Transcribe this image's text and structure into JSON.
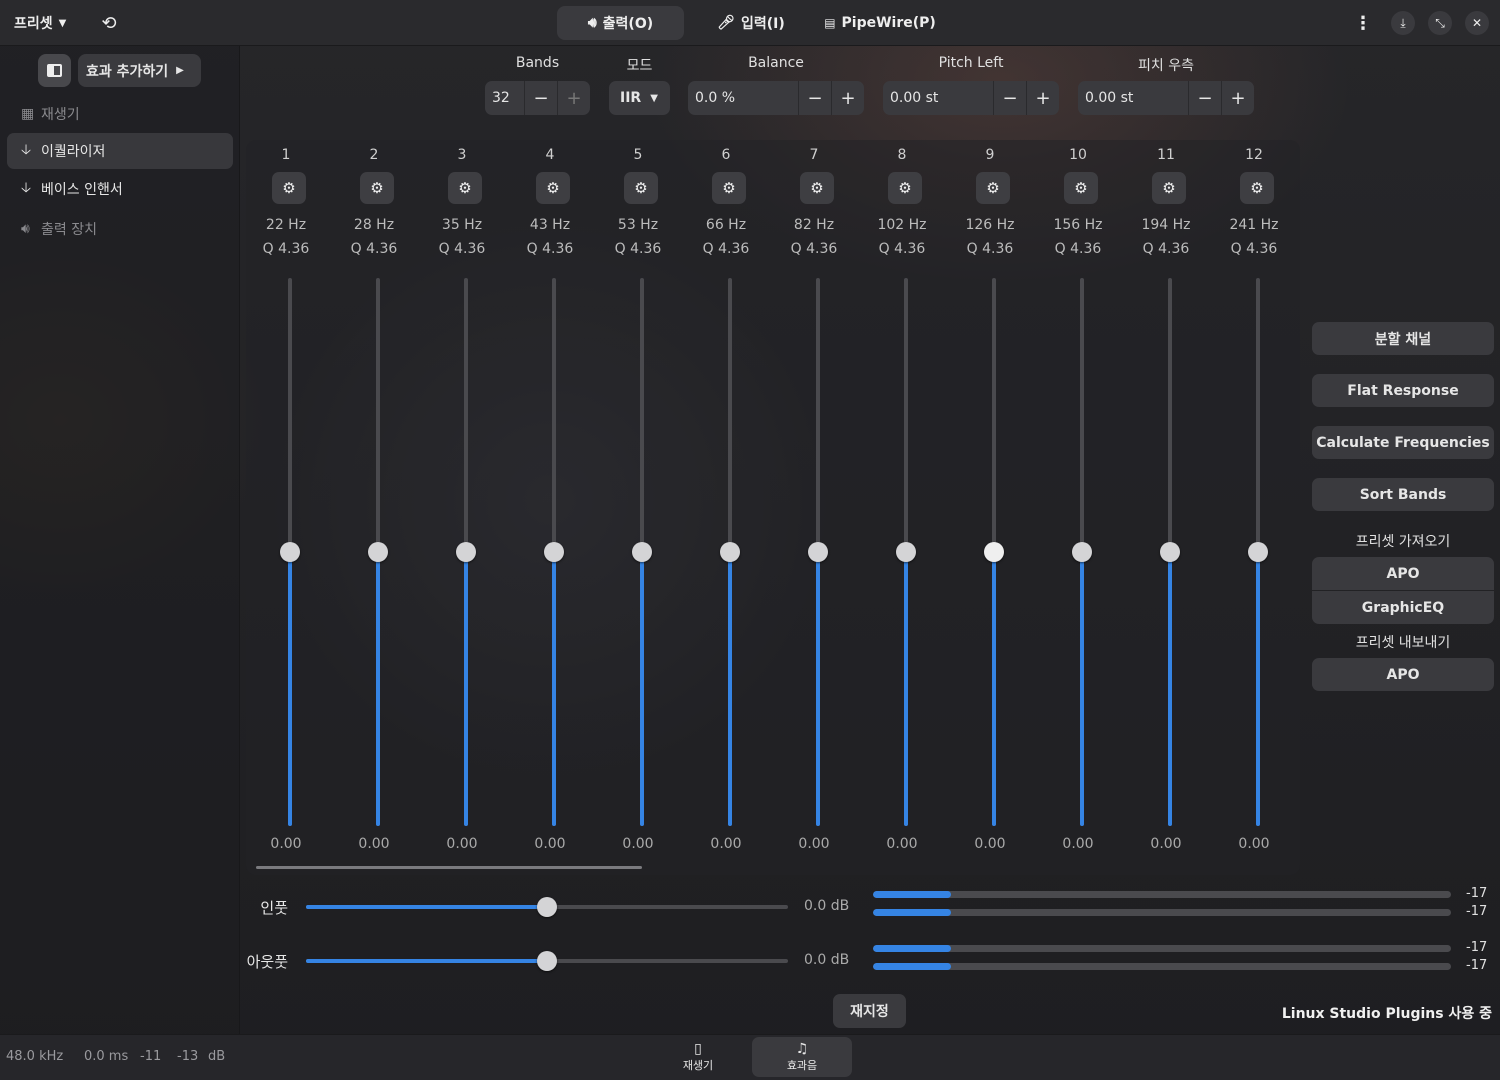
{
  "header": {
    "preset_label": "프리셋",
    "tabs": [
      {
        "label": "출력(O)",
        "icon": "speaker-icon",
        "active": true
      },
      {
        "label": "입력(I)",
        "icon": "microphone-icon",
        "active": false
      },
      {
        "label": "PipeWire(P)",
        "icon": "pipewire-icon",
        "active": false
      }
    ]
  },
  "sidebar": {
    "add_effect_label": "효과 추가하기",
    "items": [
      {
        "label": "재생기",
        "icon": "player-icon",
        "state": "dim"
      },
      {
        "label": "이퀄라이저",
        "icon": "arrow-down-icon",
        "state": "selected"
      },
      {
        "label": "베이스 인핸서",
        "icon": "arrow-down-icon",
        "state": "normal"
      },
      {
        "label": "출력 장치",
        "icon": "speaker-icon",
        "state": "dim"
      }
    ]
  },
  "controls": {
    "bands": {
      "label": "Bands",
      "value": "32"
    },
    "mode": {
      "label": "모드",
      "value": "IIR"
    },
    "balance": {
      "label": "Balance",
      "value": "0.0 %"
    },
    "pitch_left": {
      "label": "Pitch Left",
      "value": "0.00 st"
    },
    "pitch_right": {
      "label": "피치 우측",
      "value": "0.00 st"
    }
  },
  "bands": [
    {
      "num": "1",
      "freq": "22 Hz",
      "q": "Q 4.36",
      "gain": "0.00"
    },
    {
      "num": "2",
      "freq": "28 Hz",
      "q": "Q 4.36",
      "gain": "0.00"
    },
    {
      "num": "3",
      "freq": "35 Hz",
      "q": "Q 4.36",
      "gain": "0.00"
    },
    {
      "num": "4",
      "freq": "43 Hz",
      "q": "Q 4.36",
      "gain": "0.00"
    },
    {
      "num": "5",
      "freq": "53 Hz",
      "q": "Q 4.36",
      "gain": "0.00"
    },
    {
      "num": "6",
      "freq": "66 Hz",
      "q": "Q 4.36",
      "gain": "0.00"
    },
    {
      "num": "7",
      "freq": "82 Hz",
      "q": "Q 4.36",
      "gain": "0.00"
    },
    {
      "num": "8",
      "freq": "102 Hz",
      "q": "Q 4.36",
      "gain": "0.00"
    },
    {
      "num": "9",
      "freq": "126 Hz",
      "q": "Q 4.36",
      "gain": "0.00"
    },
    {
      "num": "10",
      "freq": "156 Hz",
      "q": "Q 4.36",
      "gain": "0.00"
    },
    {
      "num": "11",
      "freq": "194 Hz",
      "q": "Q 4.36",
      "gain": "0.00"
    },
    {
      "num": "12",
      "freq": "241 Hz",
      "q": "Q 4.36",
      "gain": "0.00"
    }
  ],
  "right_panel": {
    "split_channels": "분할 채널",
    "flat_response": "Flat Response",
    "calculate_frequencies": "Calculate Frequencies",
    "sort_bands": "Sort Bands",
    "import_label": "프리셋 가져오기",
    "import_apo": "APO",
    "import_graphiceq": "GraphicEQ",
    "export_label": "프리셋 내보내기",
    "export_apo": "APO"
  },
  "levels": {
    "input": {
      "label": "인풋",
      "value": "0.0 dB",
      "position": 0.5,
      "meters": [
        "-17",
        "-17"
      ],
      "meter_fill": 0.135
    },
    "output": {
      "label": "아웃풋",
      "value": "0.0 dB",
      "position": 0.5,
      "meters": [
        "-17",
        "-17"
      ],
      "meter_fill": 0.135
    }
  },
  "reset_label": "재지정",
  "plugin_status": "Linux Studio Plugins 사용 중",
  "statusbar": {
    "sample_rate": "48.0 kHz",
    "latency": "0.0 ms",
    "level_left": "-11",
    "level_right": "-13",
    "unit": "dB"
  },
  "view_switcher": [
    {
      "label": "재생기",
      "icon": "player-icon",
      "active": false
    },
    {
      "label": "효과음",
      "icon": "music-note-icon",
      "active": true
    }
  ],
  "colors": {
    "accent": "#3584e4",
    "background": "#222226"
  }
}
